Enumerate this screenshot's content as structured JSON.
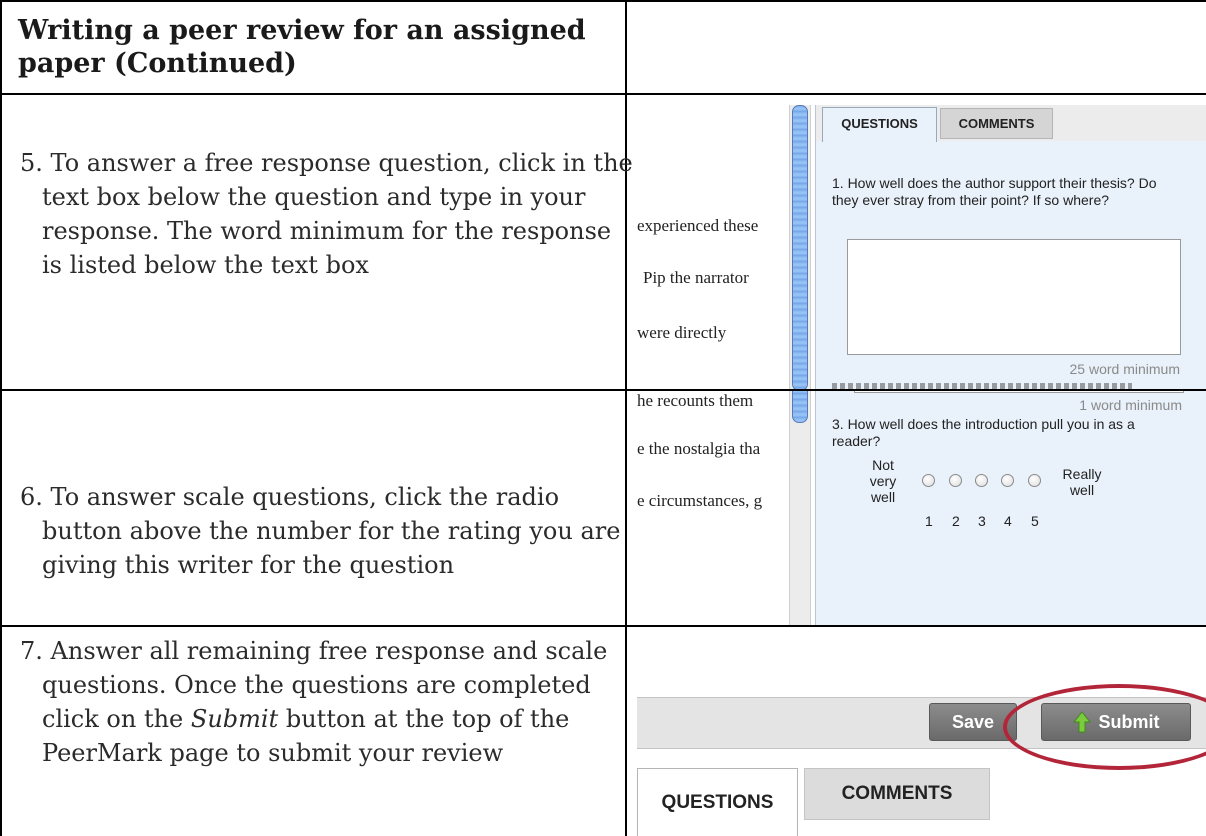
{
  "title": "Writing a peer review for an assigned paper (Continued)",
  "steps": [
    {
      "number": "5.",
      "text": "To answer a free response question, click in the text box below the question and type in your response. The word minimum for the response is listed below the text box"
    },
    {
      "number": "6.",
      "text": "To answer scale questions, click the radio button above the number for the rating you are giving this writer for the question"
    },
    {
      "number": "7.",
      "text_before": "Answer all remaining free response and scale questions. Once the questions are completed click on the ",
      "text_em": "Submit",
      "text_after": " button at the top of the PeerMark page to submit your review"
    }
  ],
  "shot1": {
    "tabs": [
      "QUESTIONS",
      "COMMENTS"
    ],
    "paper_lines": [
      "experienced these",
      "Pip the narrator",
      "were directly"
    ],
    "question": "1. How well does the author support their thesis? Do they ever stray from their point? If so where?",
    "word_min": "25 word minimum"
  },
  "shot2": {
    "paper_lines": [
      "he recounts them",
      "e the nostalgia tha",
      "e circumstances, g"
    ],
    "word_min": "1 word minimum",
    "question": "3. How well does the introduction pull you in as a reader?",
    "scale_low": "Not very well",
    "scale_high": "Really well",
    "scale_numbers": [
      "1",
      "2",
      "3",
      "4",
      "5"
    ]
  },
  "shot3": {
    "save_label": "Save",
    "submit_label": "Submit",
    "tabs": [
      "QUESTIONS",
      "COMMENTS"
    ],
    "highlight_color": "#b3263a"
  }
}
